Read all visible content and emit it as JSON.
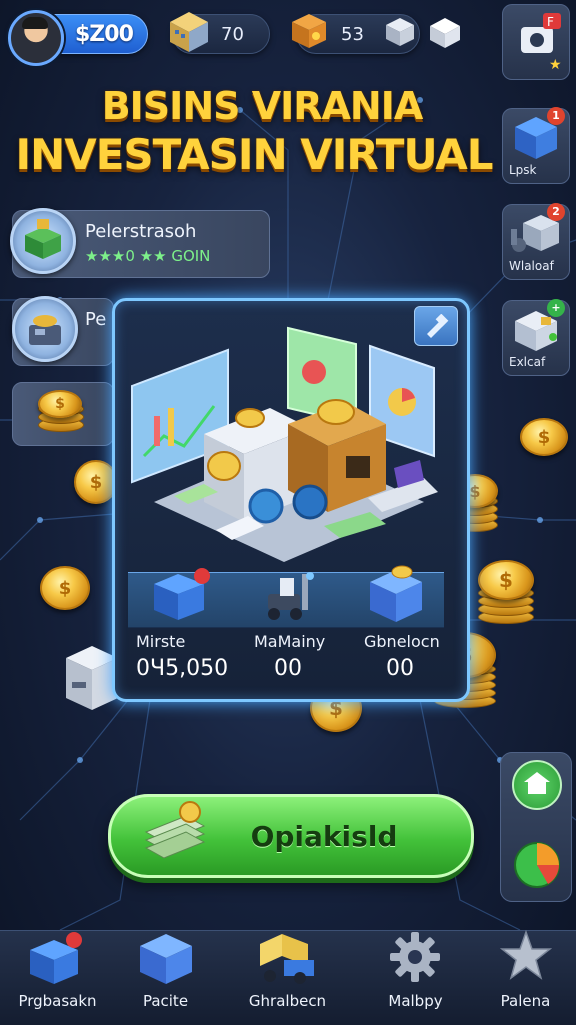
{
  "header": {
    "cash": "$Z00",
    "resource_1": "70",
    "resource_2": "53"
  },
  "title": {
    "line1": "BISINS VIRANIA",
    "line2": "INVESTASIN VIRTUAL"
  },
  "business_list": [
    {
      "name": "Pelerstrasoh",
      "rating_text": "★★★0 ★★ GOIN"
    },
    {
      "name": "Pe"
    }
  ],
  "right_rail": [
    {
      "label": "Lpsk",
      "badge": "1"
    },
    {
      "label": "Wlaloaf",
      "badge": "2"
    },
    {
      "label": "Exlcaf",
      "badge": "+"
    }
  ],
  "panel": {
    "stats": [
      {
        "label": "Mirste",
        "value": "0Ч5,050"
      },
      {
        "label": "MaMainy",
        "value": "00"
      },
      {
        "label": "Gbnelocn",
        "value": "00"
      }
    ]
  },
  "main_button": {
    "label": "Opiakisld"
  },
  "bottom_nav": [
    {
      "label": "Prgbasakn"
    },
    {
      "label": "Pacite"
    },
    {
      "label": "Ghralbecn"
    },
    {
      "label": "Malbpy"
    },
    {
      "label": "Palena"
    }
  ],
  "colors": {
    "title_gold": "#ffd23c",
    "button_green": "#43c23a",
    "panel_glow": "#7ec8ff",
    "cash_blue": "#2f7de8"
  }
}
